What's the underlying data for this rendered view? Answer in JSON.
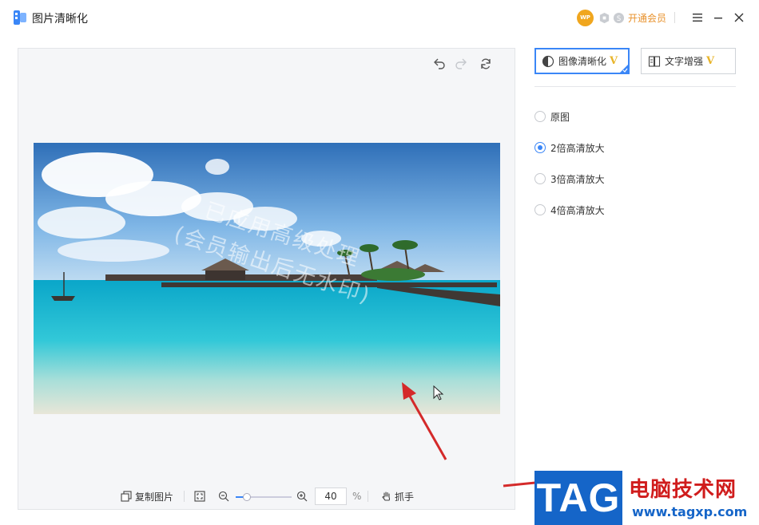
{
  "app": {
    "title": "图片清晰化"
  },
  "header": {
    "wp_badge": "WP",
    "vip_link": "开通会员",
    "icons": [
      "wp-avatar-icon",
      "gift-icon",
      "coin-icon",
      "menu-icon",
      "minimize-icon",
      "close-icon"
    ]
  },
  "canvas": {
    "toolbar_icons": [
      "undo-icon",
      "redo-icon",
      "refresh-icon"
    ],
    "watermark_line1": "已应用高级处理",
    "watermark_line2": "(会员输出后无水印)",
    "bottom": {
      "copy_label": "复制图片",
      "zoom_value": "40",
      "zoom_unit": "%",
      "hand_label": "抓手",
      "zoom_level": 0.2
    }
  },
  "modes": [
    {
      "label": "图像清晰化",
      "badge": "V",
      "active": true
    },
    {
      "label": "文字增强",
      "badge": "V",
      "active": false
    }
  ],
  "options": [
    {
      "label": "原图",
      "checked": false
    },
    {
      "label": "2倍高清放大",
      "checked": true
    },
    {
      "label": "3倍高清放大",
      "checked": false
    },
    {
      "label": "4倍高清放大",
      "checked": false
    }
  ],
  "site_watermark": {
    "tag": "TAG",
    "name": "电脑技术网",
    "url": "www.tagxp.com"
  },
  "colors": {
    "accent": "#3a86f7",
    "vip": "#e8912b",
    "arrow": "#d42a2a",
    "tag_blue": "#1565c8"
  }
}
